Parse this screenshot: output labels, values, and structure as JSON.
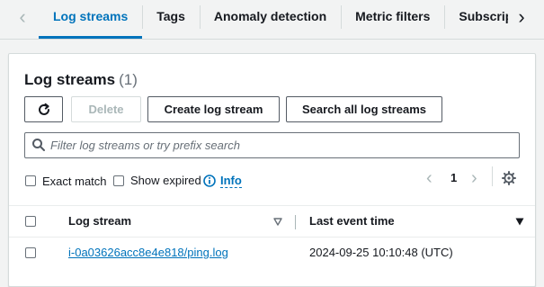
{
  "tabs": {
    "items": [
      {
        "label": "Log streams",
        "active": true
      },
      {
        "label": "Tags",
        "active": false
      },
      {
        "label": "Anomaly detection",
        "active": false
      },
      {
        "label": "Metric filters",
        "active": false
      },
      {
        "label": "Subscriptions",
        "active": false
      }
    ],
    "prev_icon": "chevron-left-icon",
    "next_icon": "chevron-right-icon"
  },
  "panel": {
    "title": "Log streams",
    "count": "(1)",
    "buttons": {
      "refresh_icon": "refresh-icon",
      "delete": "Delete",
      "create": "Create log stream",
      "search_all": "Search all log streams"
    },
    "search": {
      "placeholder": "Filter log streams or try prefix search",
      "value": ""
    },
    "options": {
      "exact_match": "Exact match",
      "show_expired": "Show expired",
      "info": "Info"
    },
    "pagination": {
      "current_page": "1"
    },
    "table": {
      "headers": {
        "log_stream": "Log stream",
        "last_event_time": "Last event time"
      },
      "rows": [
        {
          "log_stream": "i-0a03626acc8e4e818/ping.log",
          "last_event_time": "2024-09-25 10:10:48 (UTC)"
        }
      ]
    }
  },
  "colors": {
    "accent": "#0073bb",
    "text": "#16191f",
    "muted": "#687078",
    "border": "#d5dbdb",
    "background": "#f2f3f3"
  }
}
